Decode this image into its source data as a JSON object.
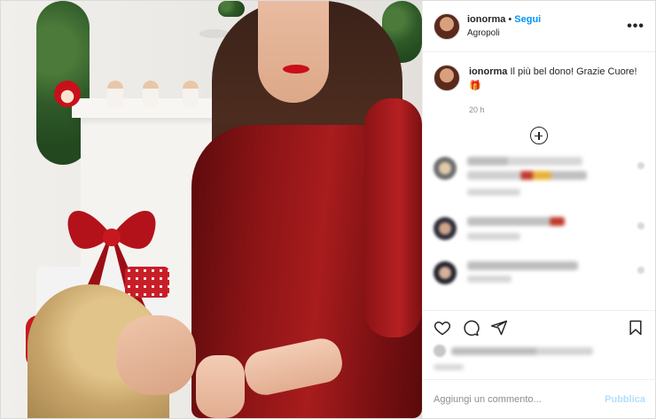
{
  "post": {
    "username": "ionorma",
    "follow_label": "Segui",
    "separator": "•",
    "location": "Agropoli",
    "more_icon": "more-horizontal-icon"
  },
  "caption": {
    "username": "ionorma",
    "text": "Il più bel dono! Grazie Cuore! 🎁",
    "time": "20 h"
  },
  "load_more_icon": "plus-circle-icon",
  "comments_blurred": 4,
  "actions": {
    "icons": [
      "heart-icon",
      "comment-icon",
      "share-icon",
      "bookmark-icon"
    ]
  },
  "add_comment": {
    "placeholder": "Aggiungi un commento...",
    "publish_label": "Pubblica"
  },
  "colors": {
    "accent": "#0095f6",
    "publish_disabled": "#b2dffc",
    "dress_red": "#a81c1d"
  }
}
